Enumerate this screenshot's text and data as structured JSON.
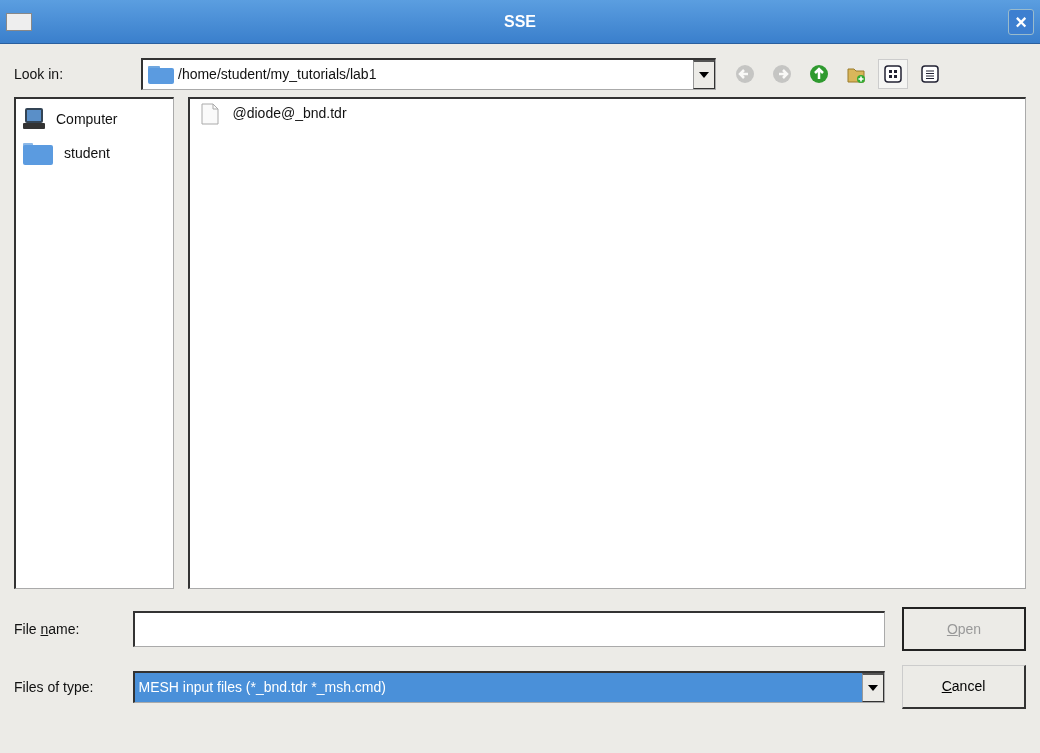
{
  "window": {
    "title": "SSE",
    "close": "×"
  },
  "look_in": {
    "label": "Look in:",
    "path": "/home/student/my_tutorials/lab1"
  },
  "toolbar": [
    {
      "kind": "back",
      "disabled": true,
      "selected": false
    },
    {
      "kind": "forward",
      "disabled": true,
      "selected": false
    },
    {
      "kind": "up",
      "disabled": false,
      "selected": false
    },
    {
      "kind": "new-folder",
      "disabled": false,
      "selected": false
    },
    {
      "kind": "icon-view",
      "disabled": false,
      "selected": true
    },
    {
      "kind": "list-view",
      "disabled": false,
      "selected": false
    }
  ],
  "sidebar": {
    "items": [
      {
        "kind": "computer",
        "label": "Computer"
      },
      {
        "kind": "folder",
        "label": "student"
      }
    ]
  },
  "files": [
    {
      "kind": "file",
      "name": "@diode@_bnd.tdr"
    }
  ],
  "file_name": {
    "label_before": "File ",
    "label_key": "n",
    "label_after": "ame:"
  },
  "file_type": {
    "label": "Files of type:",
    "value": "MESH input files (*_bnd.tdr *_msh.cmd)",
    "highlighted": true
  },
  "buttons": [
    {
      "label_key": "O",
      "label_after": "pen",
      "disabled": true
    },
    {
      "label_key": "C",
      "label_after": "ancel",
      "disabled": false
    }
  ]
}
